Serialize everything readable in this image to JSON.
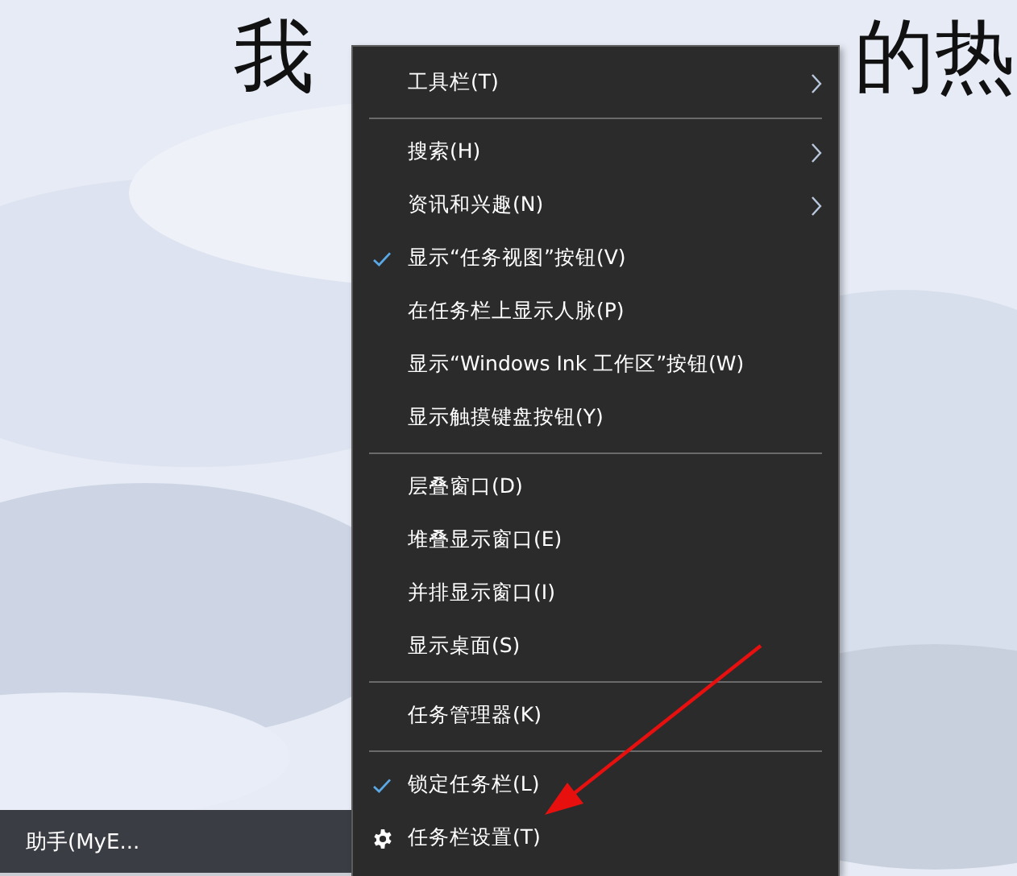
{
  "background_text": [
    "我",
    "的热"
  ],
  "taskbar": {
    "app_label": "助手(MyE...",
    "active": true
  },
  "context_menu": {
    "items": [
      {
        "kind": "item",
        "label": "工具栏(T)",
        "checked": false,
        "submenu": true
      },
      {
        "kind": "separator"
      },
      {
        "kind": "item",
        "label": "搜索(H)",
        "checked": false,
        "submenu": true
      },
      {
        "kind": "item",
        "label": "资讯和兴趣(N)",
        "checked": false,
        "submenu": true
      },
      {
        "kind": "item",
        "label": "显示“任务视图”按钮(V)",
        "checked": true,
        "submenu": false
      },
      {
        "kind": "item",
        "label": "在任务栏上显示人脉(P)",
        "checked": false,
        "submenu": false
      },
      {
        "kind": "item",
        "label": "显示“Windows Ink 工作区”按钮(W)",
        "checked": false,
        "submenu": false
      },
      {
        "kind": "item",
        "label": "显示触摸键盘按钮(Y)",
        "checked": false,
        "submenu": false
      },
      {
        "kind": "separator"
      },
      {
        "kind": "item",
        "label": "层叠窗口(D)",
        "checked": false,
        "submenu": false
      },
      {
        "kind": "item",
        "label": "堆叠显示窗口(E)",
        "checked": false,
        "submenu": false
      },
      {
        "kind": "item",
        "label": "并排显示窗口(I)",
        "checked": false,
        "submenu": false
      },
      {
        "kind": "item",
        "label": "显示桌面(S)",
        "checked": false,
        "submenu": false
      },
      {
        "kind": "separator"
      },
      {
        "kind": "item",
        "label": "任务管理器(K)",
        "checked": false,
        "submenu": false
      },
      {
        "kind": "separator"
      },
      {
        "kind": "item",
        "label": "锁定任务栏(L)",
        "checked": true,
        "submenu": false
      },
      {
        "kind": "settings",
        "label": "任务栏设置(T)"
      }
    ]
  }
}
